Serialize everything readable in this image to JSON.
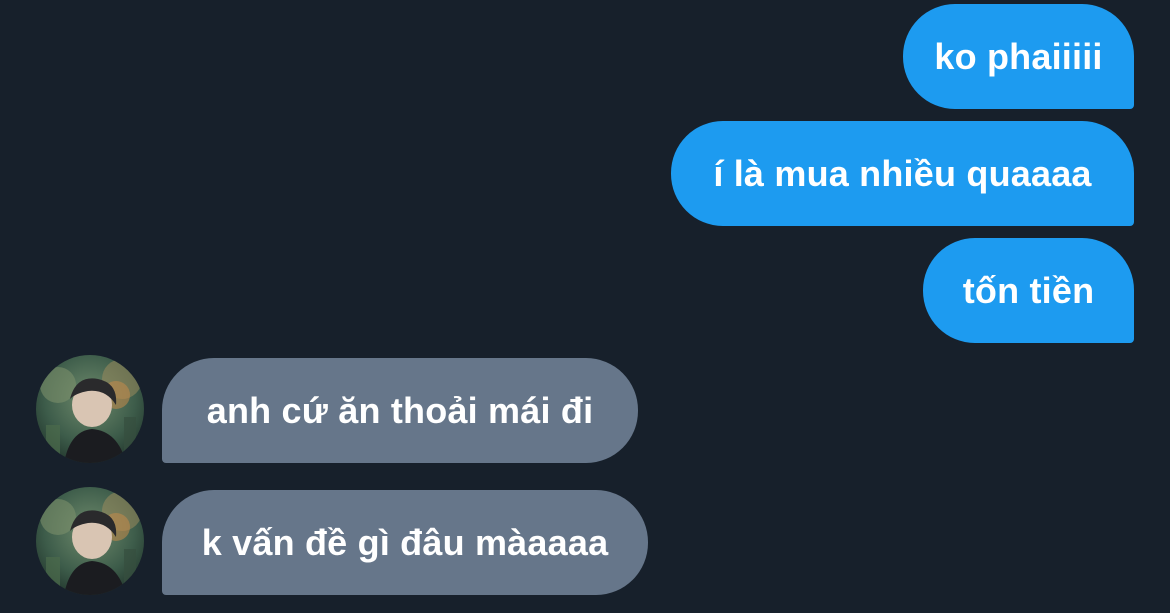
{
  "messages": [
    {
      "direction": "sent",
      "text": "ko phaiiiii"
    },
    {
      "direction": "sent",
      "text": "í là mua nhiều quaaaa"
    },
    {
      "direction": "sent",
      "text": "tốn tiền"
    },
    {
      "direction": "received",
      "text": "anh cứ ăn thoải mái đi"
    },
    {
      "direction": "received",
      "text": "k vấn đề gì đâu màaaaa"
    }
  ],
  "colors": {
    "background": "#17202b",
    "sent_bubble": "#1d9bf0",
    "received_bubble": "#66768a",
    "text": "#ffffff"
  },
  "icons": {
    "avatar": "contact-avatar-photo"
  }
}
